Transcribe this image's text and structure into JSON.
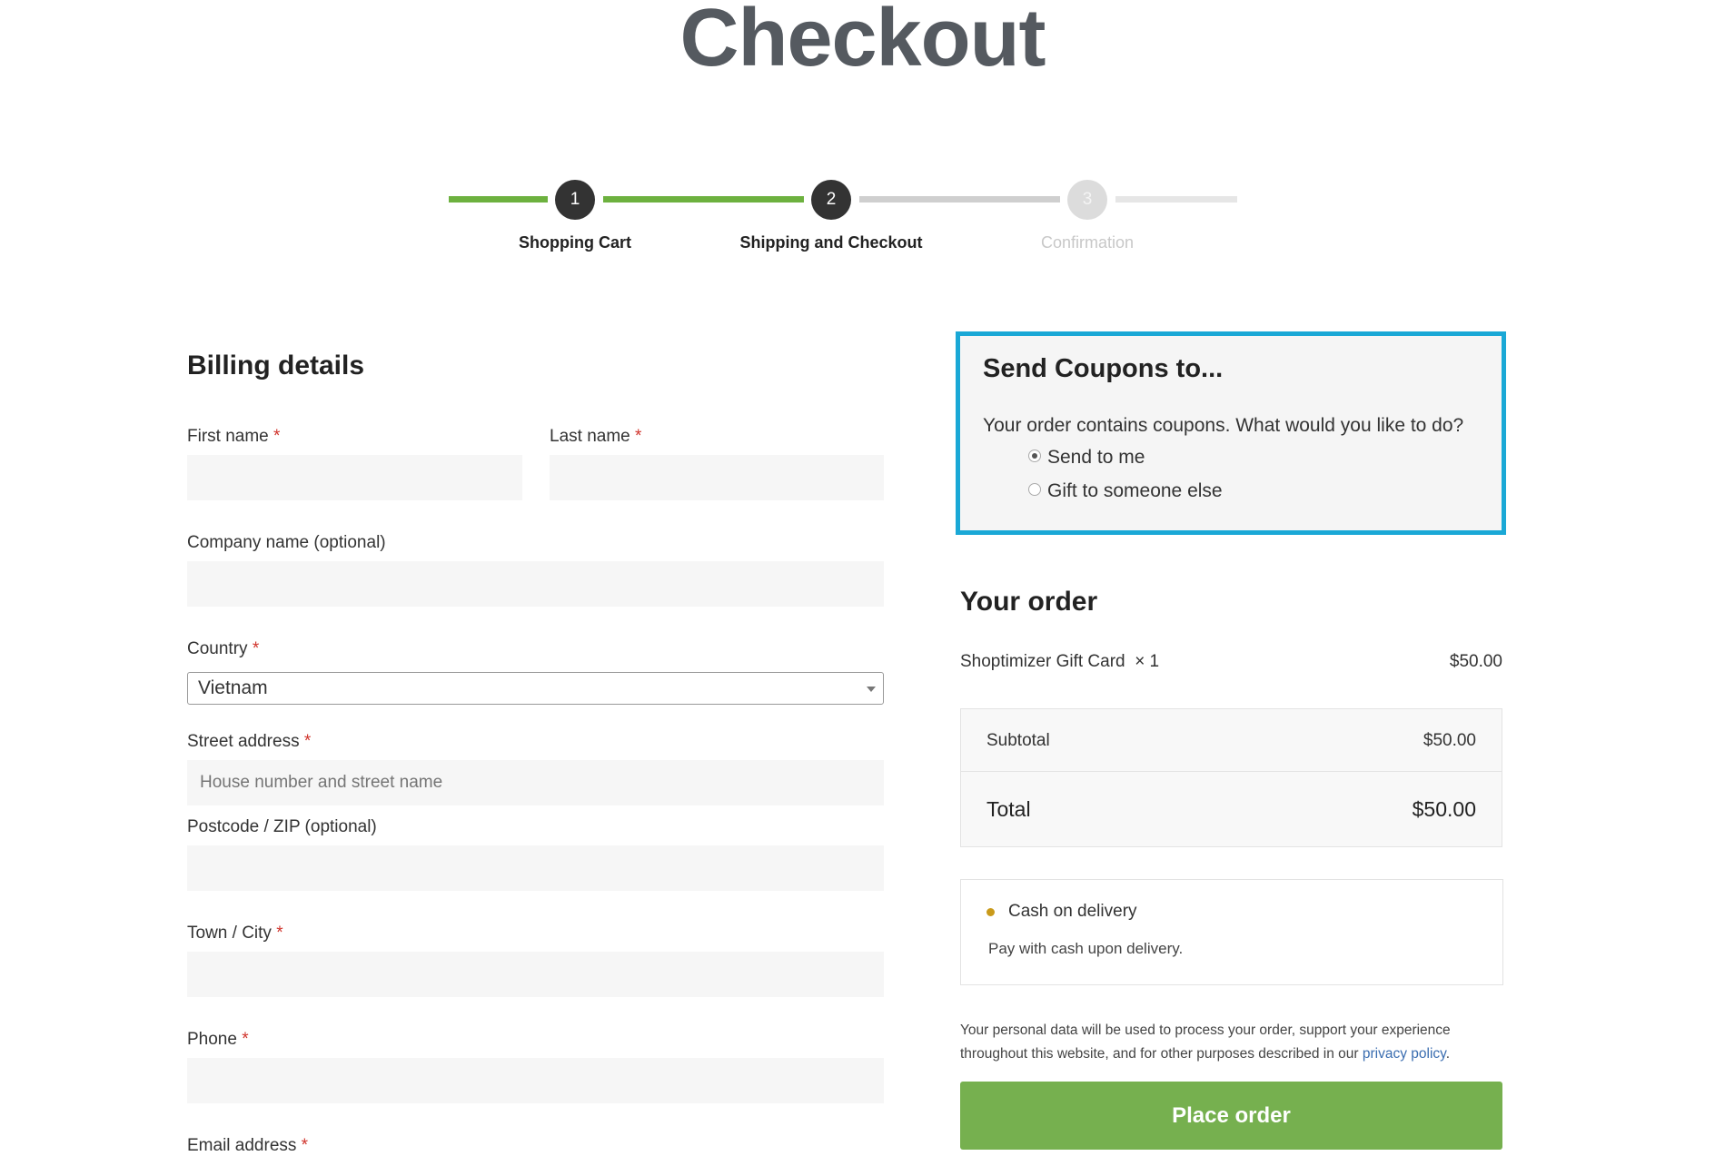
{
  "page": {
    "title": "Checkout"
  },
  "progress": {
    "steps": [
      {
        "number": "1",
        "label": "Shopping Cart",
        "state": "done"
      },
      {
        "number": "2",
        "label": "Shipping and Checkout",
        "state": "current"
      },
      {
        "number": "3",
        "label": "Confirmation",
        "state": "upcoming"
      }
    ]
  },
  "billing": {
    "heading": "Billing details",
    "required_mark": "*",
    "first_name": {
      "label": "First name",
      "value": ""
    },
    "last_name": {
      "label": "Last name",
      "value": ""
    },
    "company": {
      "label": "Company name (optional)",
      "value": ""
    },
    "country": {
      "label": "Country",
      "value": "Vietnam"
    },
    "street": {
      "label": "Street address",
      "placeholder": "House number and street name"
    },
    "postcode": {
      "label": "Postcode / ZIP (optional)",
      "value": ""
    },
    "city": {
      "label": "Town / City",
      "value": ""
    },
    "phone": {
      "label": "Phone",
      "value": ""
    },
    "email": {
      "label": "Email address",
      "value": ""
    }
  },
  "coupons": {
    "heading": "Send Coupons to...",
    "question": "Your order contains coupons. What would you like to do?",
    "options": [
      {
        "label": "Send to me",
        "checked": true
      },
      {
        "label": "Gift to someone else",
        "checked": false
      }
    ]
  },
  "order": {
    "heading": "Your order",
    "item_name": "Shoptimizer Gift Card",
    "item_qty": "× 1",
    "item_price": "$50.00",
    "subtotal_label": "Subtotal",
    "subtotal_value": "$50.00",
    "total_label": "Total",
    "total_value": "$50.00"
  },
  "payment": {
    "method": "Cash on delivery",
    "description": "Pay with cash upon delivery."
  },
  "privacy": {
    "text": "Your personal data will be used to process your order, support your experience throughout this website, and for other purposes described in our ",
    "link": "privacy policy",
    "end": "."
  },
  "place_order_label": "Place order",
  "colors": {
    "progress_done": "#6db13f",
    "coupon_border": "#1aa8d6",
    "button": "#76b04f",
    "required": "#d0342c"
  }
}
